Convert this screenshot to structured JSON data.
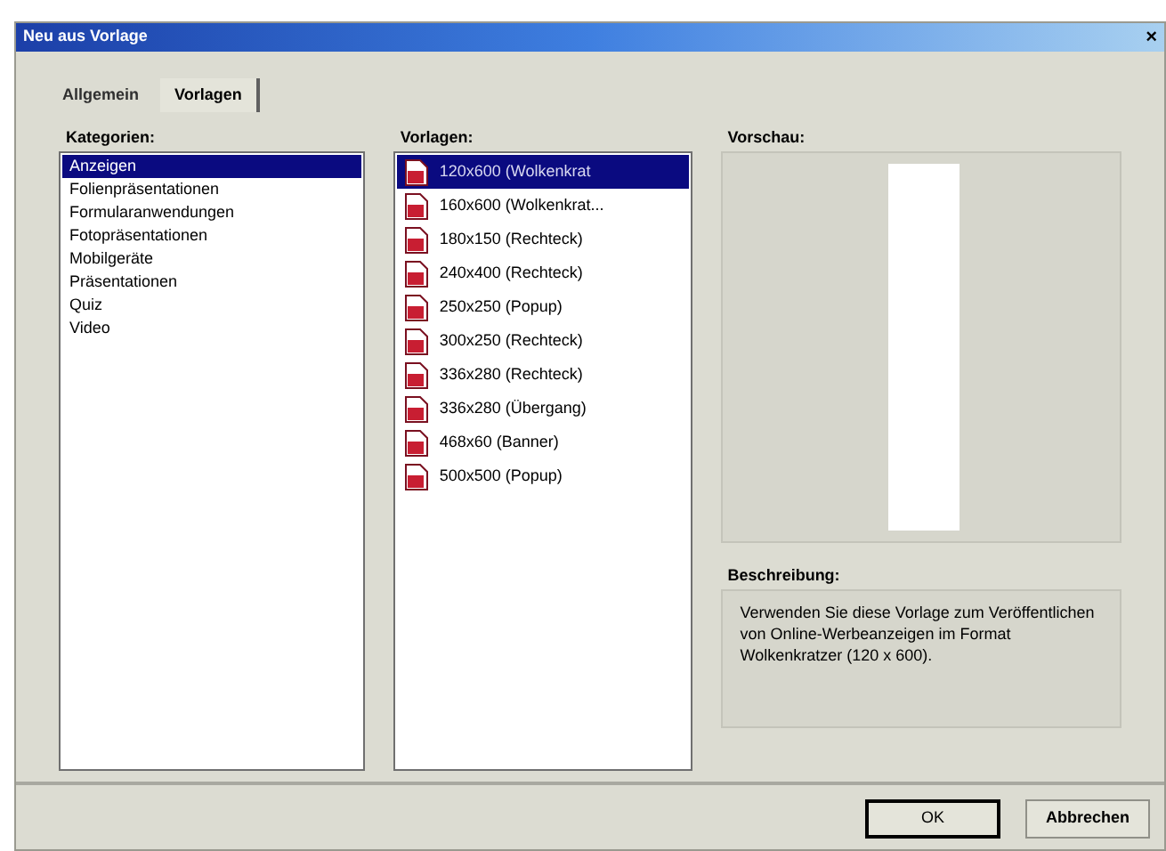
{
  "window": {
    "title": "Neu aus Vorlage",
    "close": "×"
  },
  "tabs": [
    {
      "label": "Allgemein",
      "selected": false
    },
    {
      "label": "Vorlagen",
      "selected": true
    }
  ],
  "categories": {
    "label": "Kategorien:",
    "items": [
      {
        "label": "Anzeigen",
        "selected": true
      },
      {
        "label": "Folienpräsentationen",
        "selected": false
      },
      {
        "label": "Formularanwendungen",
        "selected": false
      },
      {
        "label": "Fotopräsentationen",
        "selected": false
      },
      {
        "label": "Mobilgeräte",
        "selected": false
      },
      {
        "label": "Präsentationen",
        "selected": false
      },
      {
        "label": "Quiz",
        "selected": false
      },
      {
        "label": "Video",
        "selected": false
      }
    ]
  },
  "templates": {
    "label": "Vorlagen:",
    "items": [
      {
        "label": "120x600 (Wolkenkrat",
        "selected": true
      },
      {
        "label": "160x600 (Wolkenkrat...",
        "selected": false
      },
      {
        "label": "180x150 (Rechteck)",
        "selected": false
      },
      {
        "label": "240x400 (Rechteck)",
        "selected": false
      },
      {
        "label": "250x250 (Popup)",
        "selected": false
      },
      {
        "label": "300x250 (Rechteck)",
        "selected": false
      },
      {
        "label": "336x280 (Rechteck)",
        "selected": false
      },
      {
        "label": "336x280 (Übergang)",
        "selected": false
      },
      {
        "label": "468x60 (Banner)",
        "selected": false
      },
      {
        "label": "500x500 (Popup)",
        "selected": false
      }
    ]
  },
  "preview": {
    "label": "Vorschau:"
  },
  "description": {
    "label": "Beschreibung:",
    "text": "Verwenden Sie diese Vorlage zum Veröffentlichen von Online-Werbeanzeigen im Format Wolkenkratzer (120 x 600)."
  },
  "buttons": [
    {
      "label": "OK",
      "default": true
    },
    {
      "label": "Abbrechen",
      "default": false
    }
  ]
}
